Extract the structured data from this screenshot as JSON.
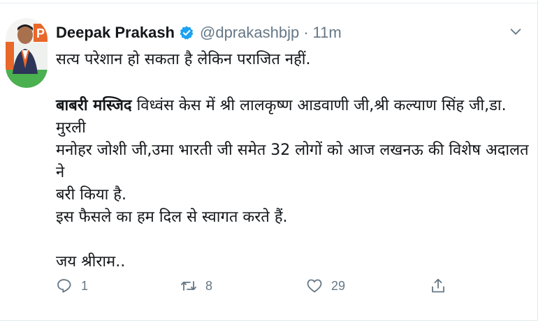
{
  "tweet": {
    "author_name": "Deepak Prakash",
    "handle": "@dprakashbjp",
    "separator": "·",
    "time": "11m",
    "line1": "सत्य परेशान हो सकता है लेकिन पराजित नहीं.",
    "bold_lead": "बाबरी मस्जिद",
    "line2_rest": " विध्वंस केस में श्री लालकृष्ण आडवाणी जी,श्री कल्याण सिंह जी,डा. मुरली",
    "line3": "मनोहर जोशी जी,उमा भारती जी समेत 32 लोगों को आज लखनऊ की विशेष अदालत ने",
    "line4": "बरी किया है.",
    "line5": "इस फैसले का हम दिल से स्वागत करते हैं.",
    "line6": "जय श्रीराम..",
    "reply_count": "1",
    "retweet_count": "8",
    "like_count": "29"
  },
  "icons": {
    "verified": "verified-badge-icon",
    "caret": "chevron-down-icon",
    "reply": "reply-icon",
    "retweet": "retweet-icon",
    "like": "heart-icon",
    "share": "share-icon"
  },
  "colors": {
    "text": "#14171a",
    "secondary": "#657786",
    "verified": "#1da1f2"
  }
}
